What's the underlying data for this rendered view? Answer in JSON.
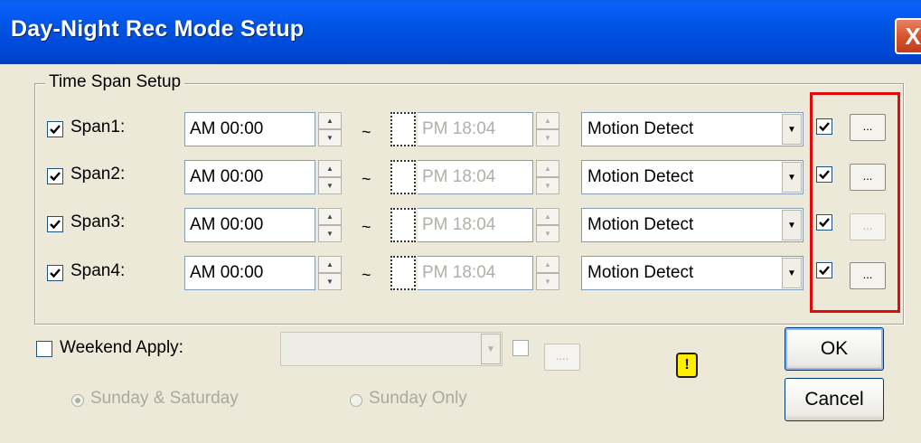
{
  "window": {
    "title": "Day-Night Rec Mode Setup",
    "close_glyph": "X"
  },
  "time_span_setup": {
    "legend": "Time Span Setup",
    "separator": "~",
    "spans": [
      {
        "label": "Span1:",
        "checked": true,
        "start": "AM 00:00",
        "end": "PM 18:04",
        "mode": "Motion Detect",
        "extra_checked": true,
        "more": "..."
      },
      {
        "label": "Span2:",
        "checked": true,
        "start": "AM 00:00",
        "end": "PM 18:04",
        "mode": "Motion Detect",
        "extra_checked": true,
        "more": "..."
      },
      {
        "label": "Span3:",
        "checked": true,
        "start": "AM 00:00",
        "end": "PM 18:04",
        "mode": "Motion Detect",
        "extra_checked": true,
        "more": "..."
      },
      {
        "label": "Span4:",
        "checked": true,
        "start": "AM 00:00",
        "end": "PM 18:04",
        "mode": "Motion Detect",
        "extra_checked": true,
        "more": "..."
      }
    ]
  },
  "weekend": {
    "label": "Weekend Apply:",
    "checked": false,
    "combo_value": "",
    "more": "....",
    "options": {
      "sunday_saturday": "Sunday & Saturday",
      "sunday_only": "Sunday Only"
    }
  },
  "warning_glyph": "!",
  "buttons": {
    "ok": "OK",
    "cancel": "Cancel"
  },
  "colors": {
    "highlight_box": "#e20a0a",
    "titlebar": "#0054e3"
  }
}
